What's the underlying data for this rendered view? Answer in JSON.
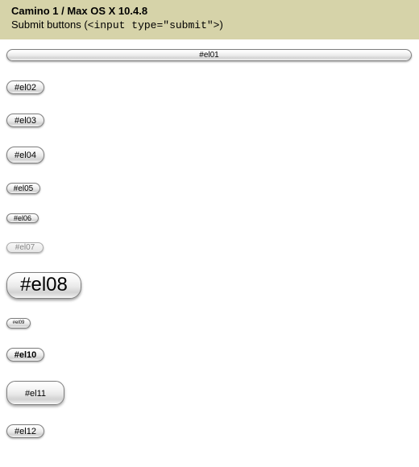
{
  "header": {
    "line1": "Camino 1 / Max OS X 10.4.8",
    "line2_prefix": "Submit buttons (",
    "line2_code": "<input type=\"submit\">",
    "line2_suffix": ")"
  },
  "buttons": {
    "el01": "#el01",
    "el02": "#el02",
    "el03": "#el03",
    "el04": "#el04",
    "el05": "#el05",
    "el06": "#el06",
    "el07": "#el07",
    "el08": "#el08",
    "el09": "#el09",
    "el10": "#el10",
    "el11": "#el11",
    "el12": "#el12"
  }
}
